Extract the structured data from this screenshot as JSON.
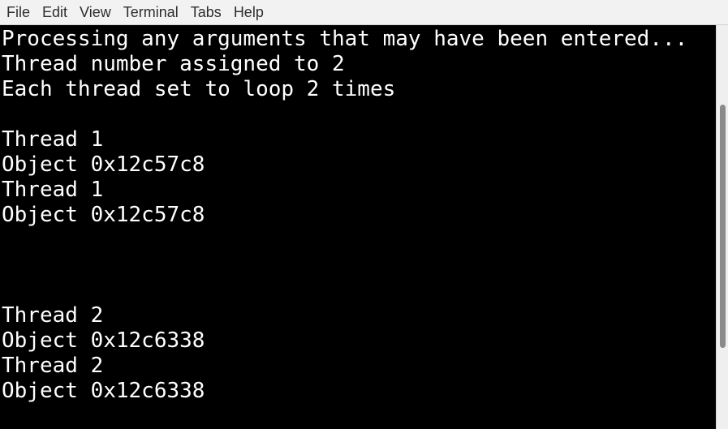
{
  "menubar": {
    "items": [
      "File",
      "Edit",
      "View",
      "Terminal",
      "Tabs",
      "Help"
    ]
  },
  "terminal": {
    "lines": [
      "Processing any arguments that may have been entered...",
      "Thread number assigned to 2",
      "Each thread set to loop 2 times",
      "",
      "Thread 1",
      "Object 0x12c57c8",
      "Thread 1",
      "Object 0x12c57c8",
      "",
      "",
      "",
      "Thread 2",
      "Object 0x12c6338",
      "Thread 2",
      "Object 0x12c6338"
    ]
  },
  "colors": {
    "terminal_background": "#000000",
    "terminal_foreground": "#ffffff",
    "menubar_background": "#f2f2f2"
  }
}
